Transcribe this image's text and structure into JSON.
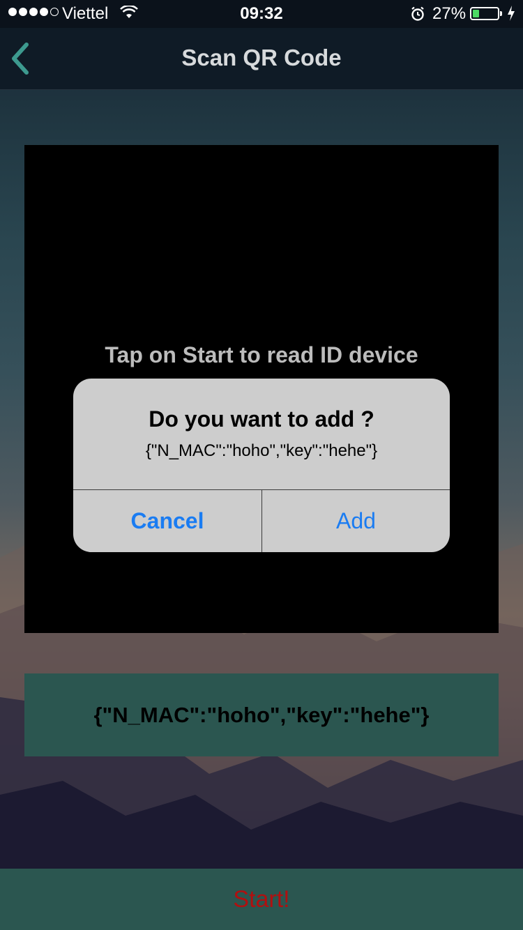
{
  "status_bar": {
    "carrier": "Viettel",
    "time": "09:32",
    "battery_percent": "27%",
    "battery_level": 0.27,
    "signal_bars_filled": 4,
    "signal_bars_total": 5,
    "icons": [
      "wifi-icon",
      "alarm-icon",
      "battery-icon",
      "charging-bolt-icon"
    ]
  },
  "nav": {
    "title": "Scan QR Code",
    "back_icon": "chevron-left-icon"
  },
  "scanner": {
    "hint": "Tap on Start to read ID device"
  },
  "alert": {
    "title": "Do you want to add ?",
    "message": "{\"N_MAC\":\"hoho\",\"key\":\"hehe\"}",
    "cancel_label": "Cancel",
    "add_label": "Add"
  },
  "result": {
    "text": "{\"N_MAC\":\"hoho\",\"key\":\"hehe\"}"
  },
  "start_button": {
    "label": "Start!"
  },
  "colors": {
    "accent_teal": "#3d9a8f",
    "ios_blue": "#1a7cf2",
    "panel_teal": "#2b5650",
    "start_red": "#b01010"
  }
}
